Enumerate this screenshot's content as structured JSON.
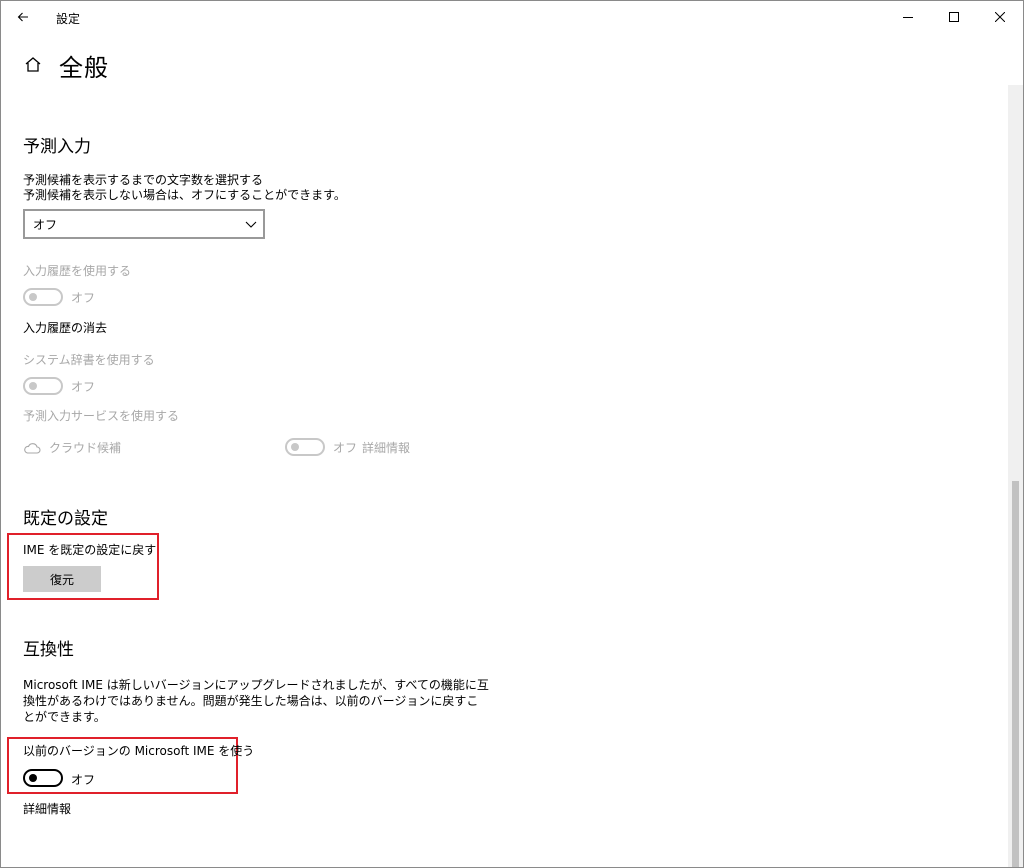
{
  "window": {
    "title": "設定",
    "back_icon": "arrow-left-icon",
    "controls": [
      "minimize-icon",
      "maximize-icon",
      "close-icon"
    ]
  },
  "page": {
    "home_icon": "home-icon",
    "title": "全般"
  },
  "prediction": {
    "title": "予測入力",
    "desc_line1": "予測候補を表示するまでの文字数を選択する",
    "desc_line2": "予測候補を表示しない場合は、オフにすることができます。",
    "dropdown_value": "オフ",
    "history_label": "入力履歴を使用する",
    "history_toggle": "オフ",
    "clear_history": "入力履歴の消去",
    "system_dict_label": "システム辞書を使用する",
    "system_dict_toggle": "オフ",
    "service_label": "予測入力サービスを使用する",
    "cloud_label": "クラウド候補",
    "cloud_toggle": "オフ",
    "more_info": "詳細情報"
  },
  "defaults": {
    "title": "既定の設定",
    "reset_label": "IME を既定の設定に戻す",
    "restore_button": "復元"
  },
  "compat": {
    "title": "互換性",
    "desc_line1": "Microsoft IME は新しいバージョンにアップグレードされましたが、すべての機能に互",
    "desc_line2": "換性があるわけではありません。問題が発生した場合は、以前のバージョンに戻すこ",
    "desc_line3": "とができます。",
    "previous_label": "以前のバージョンの Microsoft IME を使う",
    "previous_toggle": "オフ",
    "more_info": "詳細情報"
  },
  "colors": {
    "highlight": "#e0202a",
    "disabled_text": "#a8a8a8",
    "button_bg": "#cccccc"
  }
}
